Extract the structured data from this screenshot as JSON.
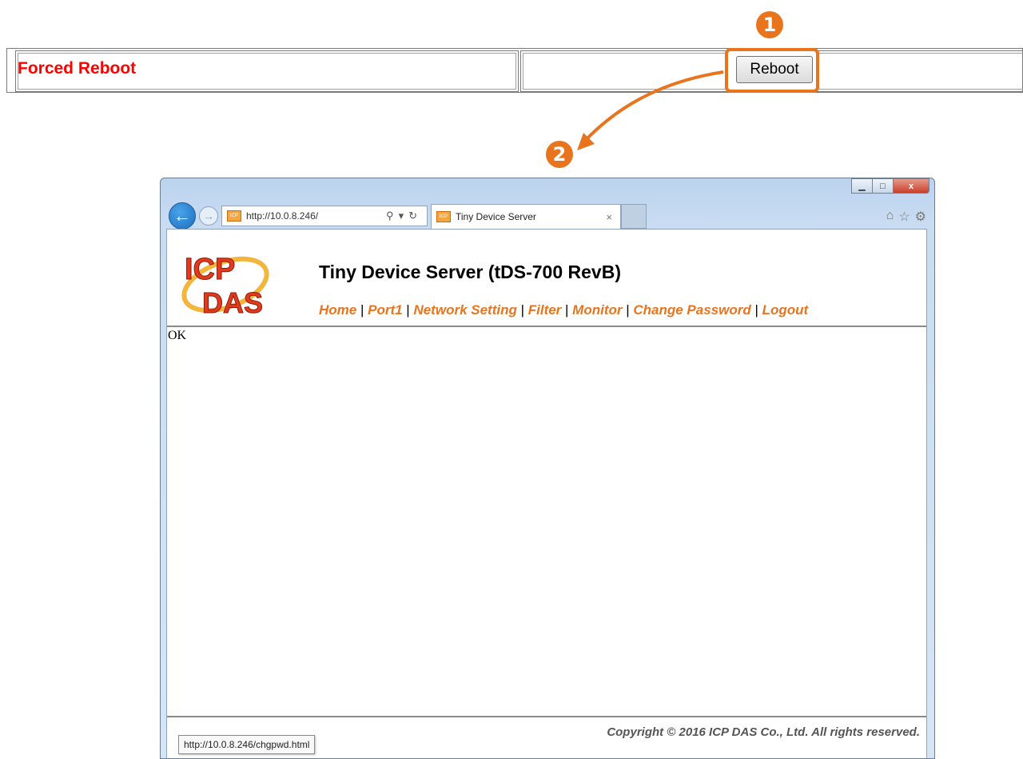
{
  "settings_row": {
    "label": "Forced Reboot",
    "button_label": "Reboot"
  },
  "callouts": {
    "step1": "❶",
    "step2": "❷"
  },
  "browser": {
    "url": "http://10.0.8.246/",
    "tab_title": "Tiny Device Server",
    "tab_close": "×",
    "window_buttons": {
      "minimize": "▁",
      "maximize": "□",
      "close": "x"
    },
    "toolbar_icons": [
      "home-icon",
      "star-icon",
      "gear-icon"
    ]
  },
  "page": {
    "logo_alt": "ICP DAS",
    "title": "Tiny Device Server (tDS-700 RevB)",
    "nav": [
      {
        "label": "Home"
      },
      {
        "label": "Port1"
      },
      {
        "label": "Network Setting"
      },
      {
        "label": "Filter"
      },
      {
        "label": "Monitor"
      },
      {
        "label": "Change Password"
      },
      {
        "label": "Logout"
      }
    ],
    "body_text": "OK",
    "copyright": "Copyright © 2016 ICP DAS Co., Ltd. All rights reserved.",
    "status_url": "http://10.0.8.246/chgpwd.html"
  },
  "colors": {
    "accent": "#e8741e",
    "label_red": "#ff0000"
  }
}
